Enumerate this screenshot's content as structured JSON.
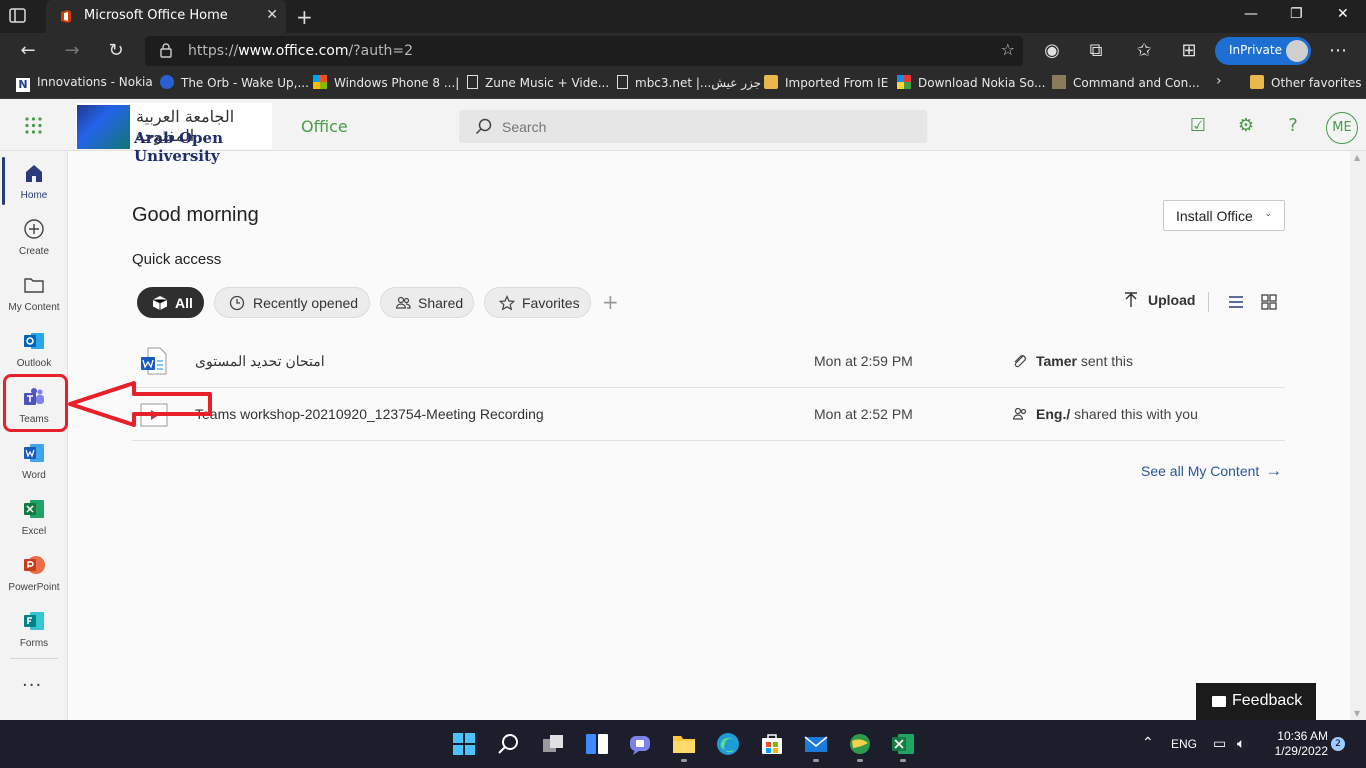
{
  "browser": {
    "tab_title": "Microsoft Office Home",
    "new_tab_label": "+",
    "url_prefix": "https://",
    "url_host": "www.office.com",
    "url_path": "/?auth=2",
    "inprivate_label": "InPrivate",
    "favorites": [
      "Innovations - Nokia",
      "The Orb - Wake Up,...",
      "Windows Phone 8 ...|",
      "Zune Music + Vide...",
      "mbc3.net |...جزر عيش",
      "Imported From IE",
      "Download Nokia So...",
      "Command and Con...",
      "Other favorites"
    ]
  },
  "header": {
    "logo_arabic": "الجامعة العربية المفتوحة",
    "logo_english": "Arab Open University",
    "brand": "Office",
    "search_placeholder": "Search",
    "avatar_initials": "ME"
  },
  "rail": {
    "items": [
      "Home",
      "Create",
      "My Content",
      "Outlook",
      "Teams",
      "Word",
      "Excel",
      "PowerPoint",
      "Forms"
    ],
    "more": "···"
  },
  "main": {
    "greeting": "Good morning",
    "install_label": "Install Office",
    "quick_access": "Quick access",
    "filters": [
      "All",
      "Recently opened",
      "Shared",
      "Favorites"
    ],
    "upload_label": "Upload",
    "files": [
      {
        "name": "امتحان تحديد المستوى",
        "date": "Mon at 2:59 PM",
        "activity_who": "Tamer",
        "activity_what": "sent this"
      },
      {
        "name": "Teams workshop-20210920_123754-Meeting Recording",
        "date": "Mon at 2:52 PM",
        "activity_who": "Eng./",
        "activity_what": "shared this with you"
      }
    ],
    "see_all": "See all My Content",
    "feedback": "Feedback"
  },
  "taskbar": {
    "language": "ENG",
    "time": "10:36 AM",
    "date": "1/29/2022",
    "notifications": "2"
  },
  "colors": {
    "office_green": "#4a9a4a",
    "inprivate_blue": "#1e6fd4",
    "annotation_red": "#e8202a",
    "link_blue": "#2b579a"
  }
}
